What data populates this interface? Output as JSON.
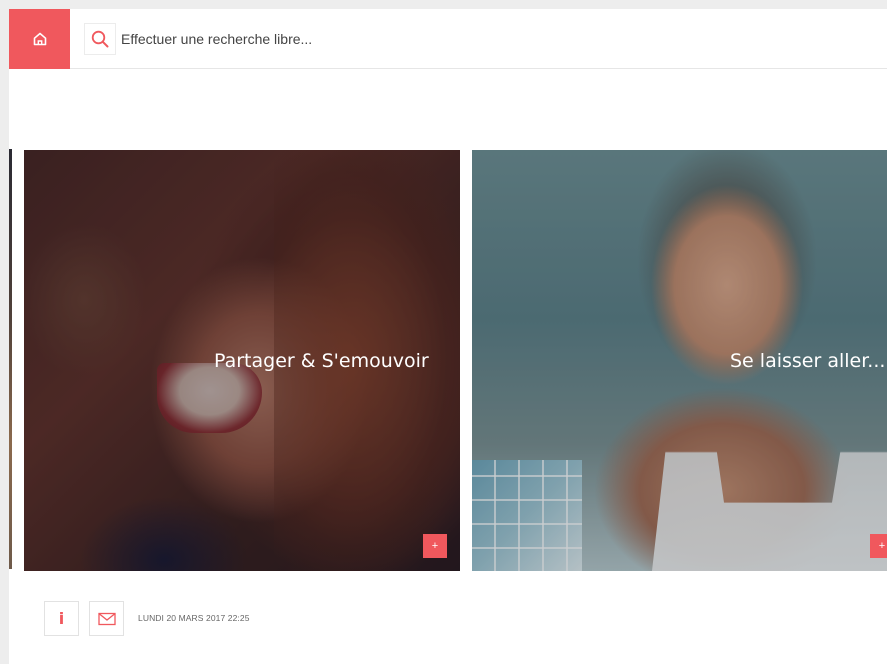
{
  "header": {
    "home_icon": "home-icon",
    "search_icon": "search-icon",
    "search_placeholder": "Effectuer une recherche libre..."
  },
  "cards": [
    {
      "title": "Partager & S'emouvoir",
      "more_label": "+"
    },
    {
      "title": "Se laisser aller...",
      "more_label": "+"
    }
  ],
  "footer": {
    "info_label": "i",
    "mail_icon": "mail-icon",
    "date": "LUNDI 20 MARS 2017 22:25"
  },
  "colors": {
    "accent": "#f0585d",
    "background": "#ffffff",
    "page_bg": "#ededed"
  }
}
